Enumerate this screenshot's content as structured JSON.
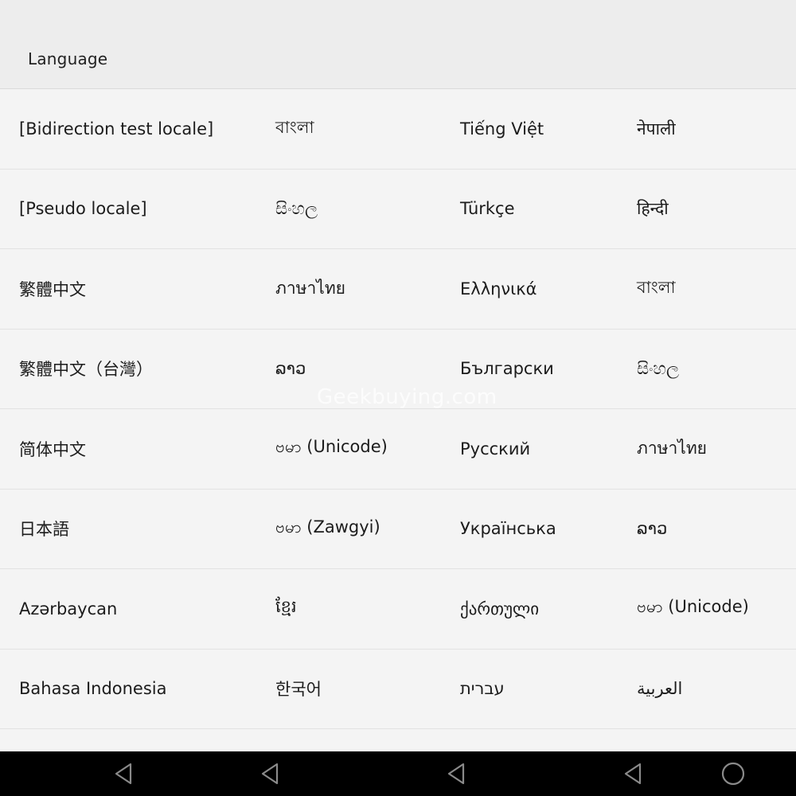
{
  "header": {
    "title": "Language"
  },
  "watermark": "Geekbuying.com",
  "panels": [
    {
      "items": [
        "[Bidirection test locale]",
        "[Pseudo locale]",
        "繁體中文",
        "繁體中文（台灣）",
        "简体中文",
        "日本語",
        "Azərbaycan",
        "Bahasa Indonesia"
      ]
    },
    {
      "items": [
        "বাংলা",
        "සිංහල",
        "ภาษาไทย",
        "ລາວ",
        "ဗမာ (Unicode)",
        "ဗမာ (Zawgyi)",
        "ខ្មែរ",
        "한국어"
      ]
    },
    {
      "items": [
        "Tiếng Việt",
        "Türkçe",
        "Ελληνικά",
        "Български",
        "Русский",
        "Українська",
        "ქართული",
        "עברית"
      ]
    },
    {
      "items": [
        "नेपाली",
        "हिन्दी",
        "বাংলা",
        "සිංහල",
        "ภาษาไทย",
        "ລາວ",
        "ဗမာ (Unicode)",
        "العربية"
      ]
    }
  ],
  "navbar": {
    "buttons": [
      {
        "icon": "back-icon"
      },
      {
        "icon": "back-icon"
      },
      {
        "icon": "back-icon"
      },
      {
        "icon": "back-icon"
      },
      {
        "icon": "home-icon"
      }
    ]
  }
}
